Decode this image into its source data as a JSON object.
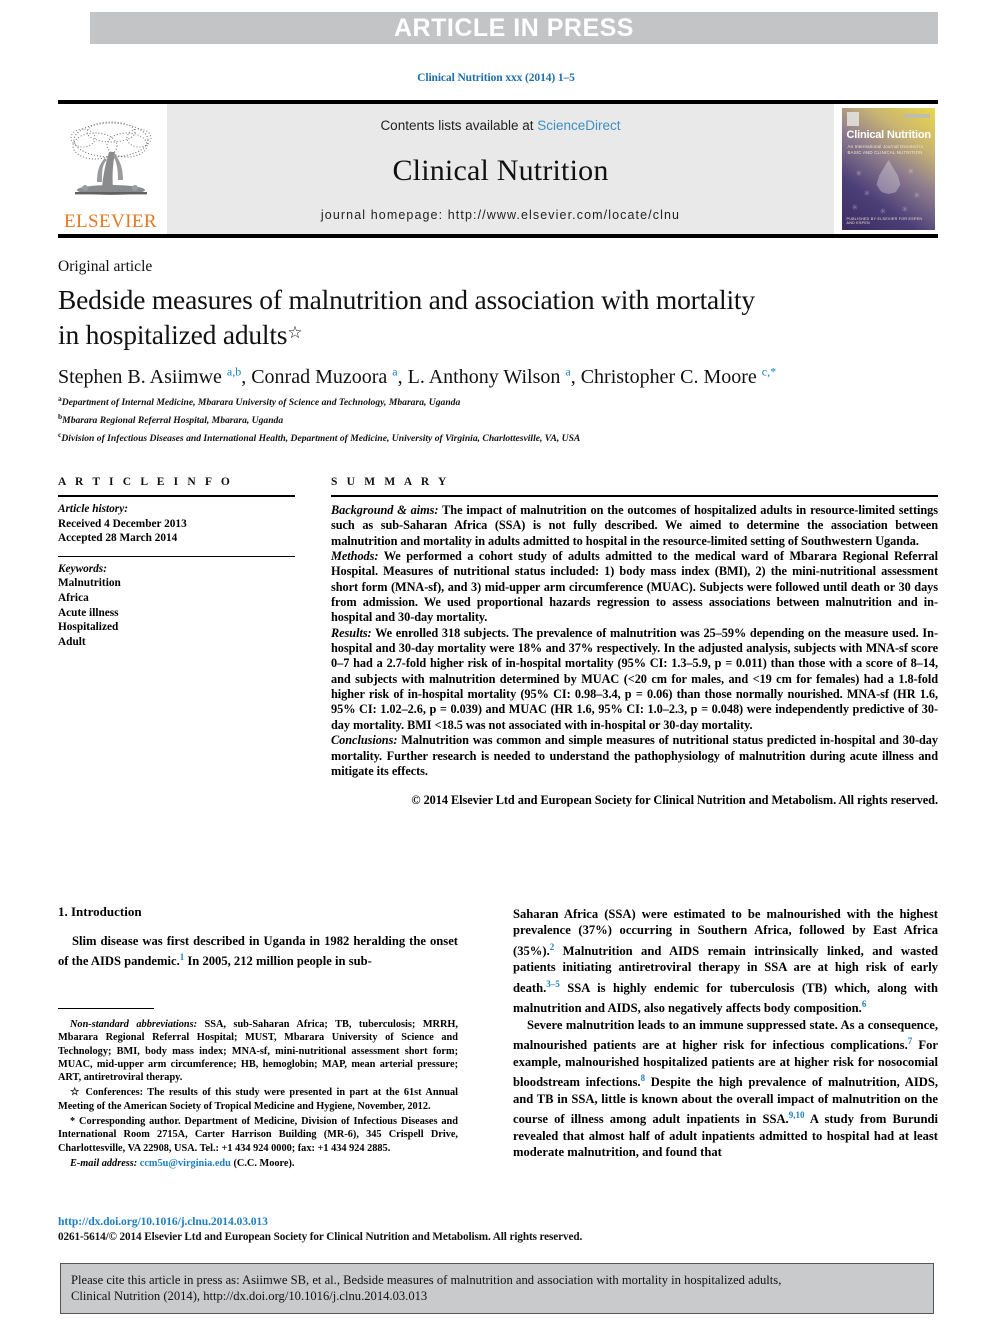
{
  "banner": {
    "label": "ARTICLE IN PRESS"
  },
  "running_head": "Clinical Nutrition xxx (2014) 1–5",
  "masthead": {
    "contents_prefix": "Contents lists available at ",
    "sciencedirect": "ScienceDirect",
    "journal_name": "Clinical Nutrition",
    "homepage": "journal homepage: http://www.elsevier.com/locate/clnu",
    "publisher": "ELSEVIER",
    "publisher_color": "#e87722",
    "link_color": "#3d8fc4",
    "cover": {
      "title": "Clinical Nutrition",
      "subtitle": "An International Journal Devoted to\nBASIC AND CLINICAL NUTRITION",
      "footer": "PUBLISHED BY ELSEVIER FOR ESPEN AND ESPEN",
      "gradient_from": "#3b2c63",
      "gradient_to": "#e8d94a"
    }
  },
  "article": {
    "type": "Original article",
    "title_line1": "Bedside measures of malnutrition and association with mortality",
    "title_line2": "in hospitalized adults",
    "title_mark": "☆",
    "authors_html": "Stephen B. Asiimwe <sup>a,b</sup>, Conrad Muzoora <sup>a</sup>, L. Anthony Wilson <sup>a</sup>, Christopher C. Moore <sup>c,*</sup>",
    "affiliations": [
      {
        "marker": "a",
        "text": "Department of Internal Medicine, Mbarara University of Science and Technology, Mbarara, Uganda"
      },
      {
        "marker": "b",
        "text": "Mbarara Regional Referral Hospital, Mbarara, Uganda"
      },
      {
        "marker": "c",
        "text": "Division of Infectious Diseases and International Health, Department of Medicine, University of Virginia, Charlottesville, VA, USA"
      }
    ]
  },
  "article_info": {
    "heading": "A R T I C L E  I N F O",
    "history_label": "Article history:",
    "received": "Received 4 December 2013",
    "accepted": "Accepted 28 March 2014",
    "keywords_label": "Keywords:",
    "keywords": [
      "Malnutrition",
      "Africa",
      "Acute illness",
      "Hospitalized",
      "Adult"
    ]
  },
  "summary": {
    "heading": "S U M M A R Y",
    "background_label": "Background & aims:",
    "background_text": " The impact of malnutrition on the outcomes of hospitalized adults in resource-limited settings such as sub-Saharan Africa (SSA) is not fully described. We aimed to determine the association between malnutrition and mortality in adults admitted to hospital in the resource-limited setting of Southwestern Uganda.",
    "methods_label": "Methods:",
    "methods_text": " We performed a cohort study of adults admitted to the medical ward of Mbarara Regional Referral Hospital. Measures of nutritional status included: 1) body mass index (BMI), 2) the mini-nutritional assessment short form (MNA-sf), and 3) mid-upper arm circumference (MUAC). Subjects were followed until death or 30 days from admission. We used proportional hazards regression to assess associations between malnutrition and in-hospital and 30-day mortality.",
    "results_label": "Results:",
    "results_text": " We enrolled 318 subjects. The prevalence of malnutrition was 25–59% depending on the measure used. In-hospital and 30-day mortality were 18% and 37% respectively. In the adjusted analysis, subjects with MNA-sf score 0–7 had a 2.7-fold higher risk of in-hospital mortality (95% CI: 1.3–5.9, p = 0.011) than those with a score of 8–14, and subjects with malnutrition determined by MUAC (<20 cm for males, and <19 cm for females) had a 1.8-fold higher risk of in-hospital mortality (95% CI: 0.98–3.4, p = 0.06) than those normally nourished. MNA-sf (HR 1.6, 95% CI: 1.02–2.6, p = 0.039) and MUAC (HR 1.6, 95% CI: 1.0–2.3, p = 0.048) were independently predictive of 30-day mortality. BMI <18.5 was not associated with in-hospital or 30-day mortality.",
    "conclusions_label": "Conclusions:",
    "conclusions_text": " Malnutrition was common and simple measures of nutritional status predicted in-hospital and 30-day mortality. Further research is needed to understand the pathophysiology of malnutrition during acute illness and mitigate its effects.",
    "copyright": "© 2014 Elsevier Ltd and European Society for Clinical Nutrition and Metabolism. All rights reserved."
  },
  "body": {
    "section_number_title": "1. Introduction",
    "left_para": "Slim disease was first described in Uganda in 1982 heralding the onset of the AIDS pandemic.",
    "left_ref1": "1",
    "left_para_cont": " In 2005, 212 million people in sub-",
    "right_para1_a": "Saharan Africa (SSA) were estimated to be malnourished with the highest prevalence (37%) occurring in Southern Africa, followed by East Africa (35%).",
    "right_ref2": "2",
    "right_para1_b": " Malnutrition and AIDS remain intrinsically linked, and wasted patients initiating antiretroviral therapy in SSA are at high risk of early death.",
    "right_ref35": "3–5",
    "right_para1_c": " SSA is highly endemic for tuberculosis (TB) which, along with malnutrition and AIDS, also negatively affects body composition.",
    "right_ref6": "6",
    "right_para2_a": "Severe malnutrition leads to an immune suppressed state. As a consequence, malnourished patients are at higher risk for infectious complications.",
    "right_ref7": "7",
    "right_para2_b": " For example, malnourished hospitalized patients are at higher risk for nosocomial bloodstream infections.",
    "right_ref8": "8",
    "right_para2_c": " Despite the high prevalence of malnutrition, AIDS, and TB in SSA, little is known about the overall impact of malnutrition on the course of illness among adult inpatients in SSA.",
    "right_ref910": "9,10",
    "right_para2_d": " A study from Burundi revealed that almost half of adult inpatients admitted to hospital had at least moderate malnutrition, and found that"
  },
  "footnotes": {
    "abbrev_label": "Non-standard abbreviations:",
    "abbrev_text": " SSA, sub-Saharan Africa; TB, tuberculosis; MRRH, Mbarara Regional Referral Hospital; MUST, Mbarara University of Science and Technology; BMI, body mass index; MNA-sf, mini-nutritional assessment short form; MUAC, mid-upper arm circumference; HB, hemoglobin; MAP, mean arterial pressure; ART, antiretroviral therapy.",
    "conf_marker": "☆",
    "conf_label": "Conferences:",
    "conf_text": " The results of this study were presented in part at the 61st Annual Meeting of the American Society of Tropical Medicine and Hygiene, November, 2012.",
    "corr_marker": "*",
    "corr_text": " Corresponding author. Department of Medicine, Division of Infectious Diseases and International Room 2715A, Carter Harrison Building (MR-6), 345 Crispell Drive, Charlottesville, VA 22908, USA. Tel.: +1 434 924 0000; fax: +1 434 924 2885.",
    "email_label": "E-mail address:",
    "email": "ccm5u@virginia.edu",
    "email_suffix": " (C.C. Moore).",
    "link_color": "#1f7fc0"
  },
  "bottom": {
    "doi": "http://dx.doi.org/10.1016/j.clnu.2014.03.013",
    "issn_line": "0261-5614/© 2014 Elsevier Ltd and European Society for Clinical Nutrition and Metabolism. All rights reserved."
  },
  "cite_box": {
    "line1": "Please cite this article in press as: Asiimwe SB, et al., Bedside measures of malnutrition and association with mortality in hospitalized adults,",
    "line2": "Clinical Nutrition (2014), http://dx.doi.org/10.1016/j.clnu.2014.03.013"
  }
}
